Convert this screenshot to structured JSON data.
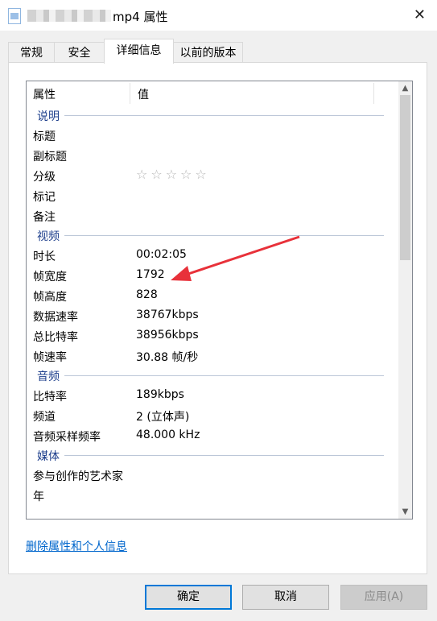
{
  "window": {
    "title_suffix": "mp4 属性",
    "close_glyph": "✕"
  },
  "tabs": [
    {
      "label": "常规"
    },
    {
      "label": "安全"
    },
    {
      "label": "详细信息"
    },
    {
      "label": "以前的版本"
    }
  ],
  "list": {
    "columns": {
      "property": "属性",
      "value": "值"
    },
    "groups": {
      "description": "说明",
      "video": "视频",
      "audio": "音频",
      "media": "媒体"
    },
    "description_rows": [
      {
        "key": "标题",
        "value": ""
      },
      {
        "key": "副标题",
        "value": ""
      },
      {
        "key": "分级",
        "value": "☆☆☆☆☆"
      },
      {
        "key": "标记",
        "value": ""
      },
      {
        "key": "备注",
        "value": ""
      }
    ],
    "video_rows": [
      {
        "key": "时长",
        "value": "00:02:05"
      },
      {
        "key": "帧宽度",
        "value": "1792"
      },
      {
        "key": "帧高度",
        "value": "828"
      },
      {
        "key": "数据速率",
        "value": "38767kbps"
      },
      {
        "key": "总比特率",
        "value": "38956kbps"
      },
      {
        "key": "帧速率",
        "value": "30.88 帧/秒"
      }
    ],
    "audio_rows": [
      {
        "key": "比特率",
        "value": "189kbps"
      },
      {
        "key": "频道",
        "value": "2 (立体声)"
      },
      {
        "key": "音频采样频率",
        "value": "48.000 kHz"
      }
    ],
    "media_rows": [
      {
        "key": "参与创作的艺术家",
        "value": ""
      },
      {
        "key": "年",
        "value": ""
      }
    ]
  },
  "rating_stars": 0,
  "remove_link": "删除属性和个人信息",
  "buttons": {
    "ok": "确定",
    "cancel": "取消",
    "apply": "应用(A)"
  },
  "colors": {
    "accent": "#0078d7",
    "annotation_arrow": "#e8313a",
    "group_header": "#1e3f8c"
  }
}
